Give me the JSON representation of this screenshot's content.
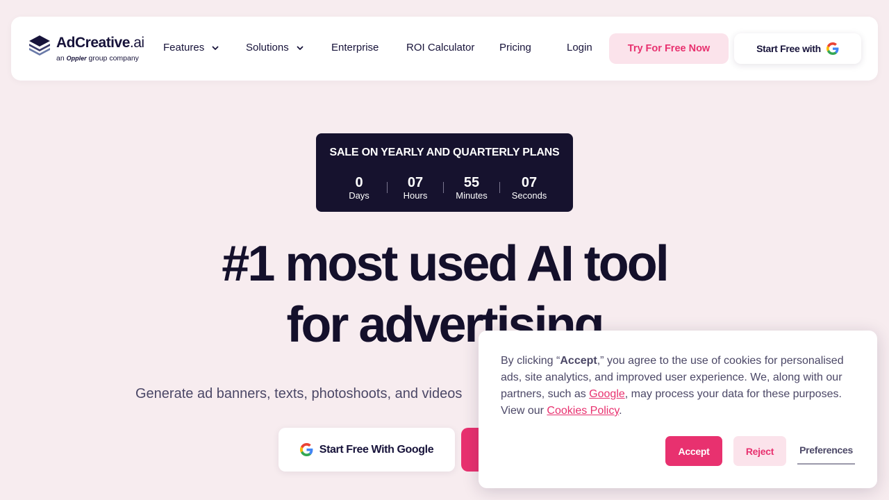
{
  "brand": {
    "name_main": "AdCreative",
    "name_suffix": ".ai",
    "sub_prefix": "an",
    "sub_group": "Oppler",
    "sub_suffix": "group company"
  },
  "nav": {
    "features": "Features",
    "solutions": "Solutions",
    "enterprise": "Enterprise",
    "roi": "ROI Calculator",
    "pricing": "Pricing",
    "login": "Login",
    "try_free": "Try For Free Now",
    "start_free_google": "Start Free with"
  },
  "sale": {
    "title": "SALE ON YEARLY AND QUARTERLY PLANS",
    "days": "0",
    "days_label": "Days",
    "hours": "07",
    "hours_label": "Hours",
    "minutes": "55",
    "minutes_label": "Minutes",
    "seconds": "07",
    "seconds_label": "Seconds"
  },
  "hero": {
    "title_line1": "#1 most used AI tool",
    "title_line2": "for advertising",
    "subtitle": "Generate ad banners, texts, photoshoots, and videos",
    "google_button": "Start Free With Google"
  },
  "cookie": {
    "t1": "By clicking “",
    "accept_word": "Accept",
    "t2": ",” you agree to the use of cookies for personalised ads, site analytics, and improved user experience. We, along with our partners, such as ",
    "google_link": "Google",
    "t3": ", may process your data for these purposes. View our ",
    "policy_link": "Cookies Policy",
    "t4": ".",
    "accept": "Accept",
    "reject": "Reject",
    "preferences": "Preferences"
  },
  "colors": {
    "accent": "#e8316f",
    "accent_soft": "#fbe3eb",
    "dark": "#16122e",
    "background": "#f7ecef"
  }
}
